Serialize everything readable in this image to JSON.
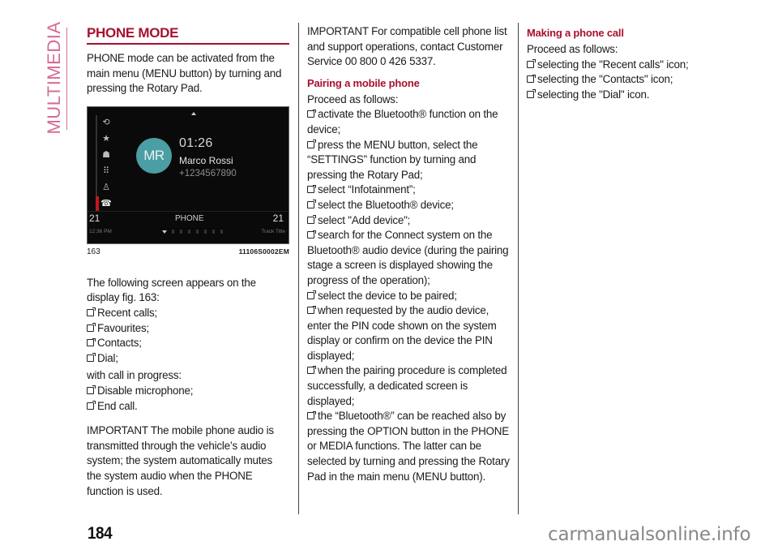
{
  "sidebar": {
    "section_label": "MULTIMEDIA"
  },
  "col1": {
    "title": "PHONE MODE",
    "intro": "PHONE mode can be activated from the main menu (MENU button) by turning and pressing the Rotary Pad.",
    "figure": {
      "avatar_initials": "MR",
      "call_time": "01:26",
      "caller_name": "Marco Rossi",
      "caller_number": "+1234567890",
      "mode_label": "PHONE",
      "left_value": "21",
      "right_value": "21",
      "status_time": "12:36 PM",
      "track_title": "Track Title",
      "sidebar_icons": [
        "recent-calls-icon",
        "favourites-icon",
        "contacts-icon",
        "dial-icon",
        "microphone-icon",
        "end-call-icon"
      ],
      "end_call_color": "#c4161c",
      "avatar_color": "#4b9ea3"
    },
    "caption_number": "163",
    "caption_code": "11106S0002EM",
    "screen_text": "The following screen appears on the display fig. 163:",
    "screen_items": [
      "Recent calls;",
      "Favourites;",
      "Contacts;",
      "Dial;"
    ],
    "in_progress_text": "with call in progress:",
    "in_progress_items": [
      "Disable microphone;",
      "End call."
    ],
    "important": "IMPORTANT The mobile phone audio is transmitted through the vehicle’s audio system; the system automatically mutes the system audio when the PHONE function is used."
  },
  "col2": {
    "important": "IMPORTANT For compatible cell phone list and support operations, contact Customer Service 00 800 0 426 5337.",
    "heading": "Pairing a mobile phone",
    "proceed": "Proceed as follows:",
    "steps": [
      "activate the Bluetooth® function on the device;",
      "press the MENU button, select the “SETTINGS” function by turning and pressing the Rotary Pad;",
      "select “Infotainment”;",
      "select the Bluetooth® device;",
      "select \"Add device\";",
      "search for the Connect system on the Bluetooth® audio device (during the pairing stage a screen is displayed showing the progress of the operation);",
      "select the device to be paired;",
      "when requested by the audio device, enter the PIN code shown on the system display or confirm on the device the PIN displayed;",
      "when the pairing procedure is completed successfully, a dedicated screen is displayed;",
      "the “Bluetooth®” can be reached also by pressing the OPTION button in the PHONE or MEDIA functions. The latter can be selected by turning and pressing the Rotary Pad in the main menu (MENU button)."
    ]
  },
  "col3": {
    "heading": "Making a phone call",
    "proceed": "Proceed as follows:",
    "steps": [
      "selecting the \"Recent calls\" icon;",
      "selecting the \"Contacts\" icon;",
      "selecting the \"Dial\" icon."
    ]
  },
  "footer": {
    "page_number": "184",
    "watermark": "carmanualsonline.info"
  },
  "colors": {
    "accent": "#a8102e",
    "sidebar_label": "#d56b95"
  }
}
